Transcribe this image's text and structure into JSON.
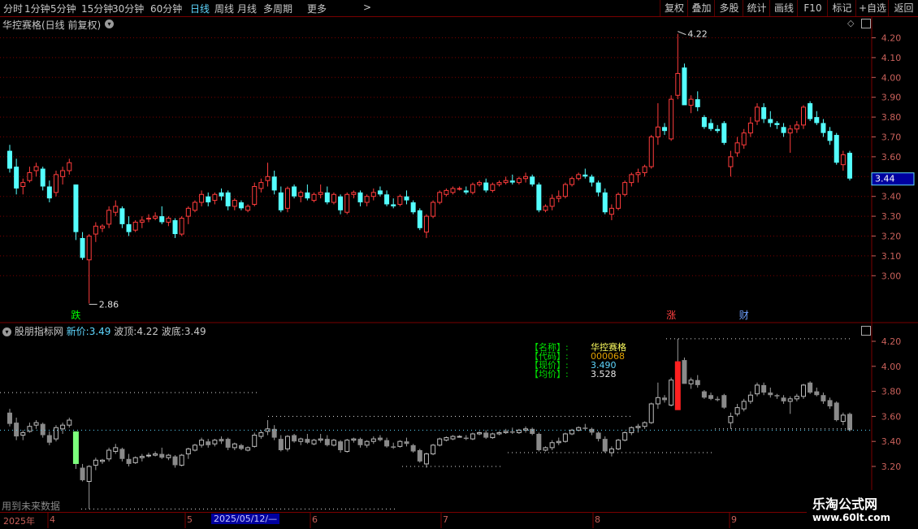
{
  "toolbar": {
    "periods": [
      "分时",
      "1分钟",
      "5分钟",
      "15分钟",
      "30分钟",
      "60分钟",
      "日线",
      "周线",
      "月线",
      "多周期",
      "更多"
    ],
    "more_arrow": ">",
    "active": "日线",
    "right_buttons": [
      "复权",
      "叠加",
      "多股",
      "统计",
      "画线",
      "F10",
      "标记",
      "+自选",
      "返回"
    ]
  },
  "main_panel": {
    "title": "华控赛格(日线 前复权)",
    "price_ticks": [
      "4.20",
      "4.10",
      "4.00",
      "3.90",
      "3.80",
      "3.70",
      "3.60",
      "3.50",
      "3.40",
      "3.30",
      "3.20",
      "3.10",
      "3.00"
    ],
    "current_price": "3.44",
    "high_label": "4.22",
    "low_label": "2.86",
    "markers": [
      {
        "text": "跌",
        "color": "#00ff00"
      },
      {
        "text": "涨",
        "color": "#ff4040"
      },
      {
        "text": "财",
        "color": "#6fa0ff"
      }
    ]
  },
  "sub_panel": {
    "name": "股朋指标网",
    "new_price_label": "新价:",
    "new_price": "3.49",
    "wave_top_label": "波顶:",
    "wave_top": "4.22",
    "wave_bottom_label": "波底:",
    "wave_bottom": "3.49",
    "ticks": [
      "4.20",
      "4.00",
      "3.80",
      "3.60",
      "3.40",
      "3.20"
    ],
    "info": [
      {
        "label": "【名称】:",
        "value": "华控赛格",
        "color": "#ffff60"
      },
      {
        "label": "【代码】:",
        "value": "000068",
        "color": "#e0a000"
      },
      {
        "label": "【现价】:",
        "value": "3.490",
        "color": "#5fd7ff"
      },
      {
        "label": "【均价】:",
        "value": "3.528",
        "color": "#e8e8e8"
      }
    ],
    "future_note": "用到未来数据"
  },
  "date_axis": {
    "labels": [
      "2025年",
      "4",
      "5",
      "6",
      "7",
      "8",
      "9"
    ],
    "cursor_date": "2025/05/12/—"
  },
  "watermark": {
    "line1": "乐淘公式网",
    "line2": "www.60lt.com"
  },
  "colors": {
    "up": "#ff3c3c",
    "down": "#54ffff",
    "grid": "#7a0000",
    "accent": "#5fd7ff"
  },
  "chart_data": {
    "type": "candlestick",
    "candles": [
      [
        3.63,
        3.66,
        3.52,
        3.54
      ],
      [
        3.55,
        3.59,
        3.41,
        3.44
      ],
      [
        3.45,
        3.49,
        3.41,
        3.47
      ],
      [
        3.48,
        3.55,
        3.47,
        3.52
      ],
      [
        3.53,
        3.57,
        3.5,
        3.55
      ],
      [
        3.54,
        3.55,
        3.43,
        3.45
      ],
      [
        3.45,
        3.48,
        3.37,
        3.39
      ],
      [
        3.42,
        3.53,
        3.4,
        3.51
      ],
      [
        3.5,
        3.55,
        3.46,
        3.53
      ],
      [
        3.53,
        3.59,
        3.51,
        3.57
      ],
      [
        3.46,
        3.46,
        3.18,
        3.22
      ],
      [
        3.19,
        3.22,
        3.08,
        3.09
      ],
      [
        3.08,
        3.21,
        2.86,
        3.2
      ],
      [
        3.21,
        3.27,
        3.17,
        3.25
      ],
      [
        3.24,
        3.26,
        3.22,
        3.25
      ],
      [
        3.26,
        3.35,
        3.24,
        3.33
      ],
      [
        3.32,
        3.38,
        3.3,
        3.35
      ],
      [
        3.34,
        3.35,
        3.24,
        3.26
      ],
      [
        3.26,
        3.3,
        3.2,
        3.22
      ],
      [
        3.23,
        3.28,
        3.22,
        3.27
      ],
      [
        3.27,
        3.3,
        3.24,
        3.28
      ],
      [
        3.29,
        3.31,
        3.27,
        3.29
      ],
      [
        3.29,
        3.32,
        3.28,
        3.3
      ],
      [
        3.3,
        3.35,
        3.26,
        3.27
      ],
      [
        3.27,
        3.3,
        3.25,
        3.29
      ],
      [
        3.28,
        3.29,
        3.19,
        3.21
      ],
      [
        3.21,
        3.3,
        3.2,
        3.29
      ],
      [
        3.3,
        3.35,
        3.26,
        3.34
      ],
      [
        3.33,
        3.38,
        3.32,
        3.37
      ],
      [
        3.37,
        3.43,
        3.35,
        3.41
      ],
      [
        3.4,
        3.42,
        3.35,
        3.37
      ],
      [
        3.38,
        3.42,
        3.36,
        3.41
      ],
      [
        3.42,
        3.44,
        3.38,
        3.4
      ],
      [
        3.42,
        3.43,
        3.33,
        3.35
      ],
      [
        3.35,
        3.39,
        3.33,
        3.38
      ],
      [
        3.37,
        3.38,
        3.33,
        3.34
      ],
      [
        3.33,
        3.36,
        3.32,
        3.35
      ],
      [
        3.36,
        3.47,
        3.35,
        3.45
      ],
      [
        3.44,
        3.49,
        3.42,
        3.47
      ],
      [
        3.48,
        3.57,
        3.45,
        3.5
      ],
      [
        3.5,
        3.53,
        3.41,
        3.43
      ],
      [
        3.42,
        3.45,
        3.32,
        3.33
      ],
      [
        3.34,
        3.45,
        3.32,
        3.44
      ],
      [
        3.45,
        3.46,
        3.39,
        3.4
      ],
      [
        3.4,
        3.43,
        3.37,
        3.42
      ],
      [
        3.42,
        3.46,
        3.38,
        3.39
      ],
      [
        3.38,
        3.42,
        3.37,
        3.41
      ],
      [
        3.41,
        3.46,
        3.39,
        3.42
      ],
      [
        3.42,
        3.45,
        3.36,
        3.37
      ],
      [
        3.37,
        3.42,
        3.36,
        3.41
      ],
      [
        3.4,
        3.41,
        3.31,
        3.33
      ],
      [
        3.32,
        3.42,
        3.31,
        3.41
      ],
      [
        3.41,
        3.43,
        3.39,
        3.42
      ],
      [
        3.42,
        3.43,
        3.35,
        3.37
      ],
      [
        3.37,
        3.41,
        3.35,
        3.4
      ],
      [
        3.4,
        3.44,
        3.38,
        3.42
      ],
      [
        3.43,
        3.45,
        3.4,
        3.41
      ],
      [
        3.41,
        3.43,
        3.35,
        3.36
      ],
      [
        3.36,
        3.39,
        3.34,
        3.35
      ],
      [
        3.36,
        3.41,
        3.35,
        3.4
      ],
      [
        3.4,
        3.43,
        3.36,
        3.38
      ],
      [
        3.37,
        3.38,
        3.31,
        3.32
      ],
      [
        3.33,
        3.34,
        3.23,
        3.24
      ],
      [
        3.22,
        3.31,
        3.19,
        3.3
      ],
      [
        3.3,
        3.38,
        3.29,
        3.37
      ],
      [
        3.37,
        3.43,
        3.36,
        3.42
      ],
      [
        3.41,
        3.44,
        3.4,
        3.43
      ],
      [
        3.42,
        3.45,
        3.41,
        3.44
      ],
      [
        3.44,
        3.45,
        3.43,
        3.44
      ],
      [
        3.43,
        3.45,
        3.41,
        3.42
      ],
      [
        3.42,
        3.47,
        3.41,
        3.46
      ],
      [
        3.46,
        3.48,
        3.45,
        3.47
      ],
      [
        3.47,
        3.49,
        3.42,
        3.43
      ],
      [
        3.43,
        3.47,
        3.42,
        3.46
      ],
      [
        3.46,
        3.48,
        3.45,
        3.47
      ],
      [
        3.47,
        3.5,
        3.46,
        3.48
      ],
      [
        3.48,
        3.51,
        3.46,
        3.47
      ],
      [
        3.47,
        3.5,
        3.46,
        3.49
      ],
      [
        3.49,
        3.52,
        3.47,
        3.5
      ],
      [
        3.5,
        3.51,
        3.45,
        3.46
      ],
      [
        3.46,
        3.47,
        3.32,
        3.33
      ],
      [
        3.33,
        3.36,
        3.32,
        3.35
      ],
      [
        3.35,
        3.41,
        3.33,
        3.39
      ],
      [
        3.39,
        3.43,
        3.37,
        3.4
      ],
      [
        3.4,
        3.47,
        3.39,
        3.46
      ],
      [
        3.46,
        3.5,
        3.45,
        3.49
      ],
      [
        3.49,
        3.52,
        3.48,
        3.51
      ],
      [
        3.51,
        3.54,
        3.49,
        3.5
      ],
      [
        3.5,
        3.51,
        3.45,
        3.47
      ],
      [
        3.47,
        3.48,
        3.4,
        3.42
      ],
      [
        3.42,
        3.44,
        3.31,
        3.32
      ],
      [
        3.31,
        3.36,
        3.28,
        3.34
      ],
      [
        3.34,
        3.42,
        3.33,
        3.41
      ],
      [
        3.41,
        3.48,
        3.4,
        3.47
      ],
      [
        3.47,
        3.52,
        3.45,
        3.51
      ],
      [
        3.51,
        3.54,
        3.47,
        3.52
      ],
      [
        3.52,
        3.56,
        3.5,
        3.55
      ],
      [
        3.55,
        3.71,
        3.54,
        3.7
      ],
      [
        3.7,
        3.87,
        3.66,
        3.75
      ],
      [
        3.75,
        3.77,
        3.71,
        3.73
      ],
      [
        3.69,
        3.91,
        3.68,
        3.89
      ],
      [
        3.91,
        4.22,
        3.89,
        4.02
      ],
      [
        4.05,
        4.07,
        3.88,
        3.86
      ],
      [
        3.86,
        3.91,
        3.82,
        3.89
      ],
      [
        3.89,
        3.93,
        3.83,
        3.85
      ],
      [
        3.8,
        3.81,
        3.74,
        3.75
      ],
      [
        3.77,
        3.79,
        3.73,
        3.74
      ],
      [
        3.74,
        3.76,
        3.72,
        3.73
      ],
      [
        3.77,
        3.78,
        3.66,
        3.67
      ],
      [
        3.55,
        3.63,
        3.5,
        3.6
      ],
      [
        3.62,
        3.7,
        3.6,
        3.67
      ],
      [
        3.66,
        3.74,
        3.64,
        3.72
      ],
      [
        3.72,
        3.8,
        3.7,
        3.77
      ],
      [
        3.78,
        3.87,
        3.76,
        3.85
      ],
      [
        3.85,
        3.87,
        3.77,
        3.79
      ],
      [
        3.79,
        3.83,
        3.75,
        3.77
      ],
      [
        3.77,
        3.78,
        3.74,
        3.76
      ],
      [
        3.75,
        3.77,
        3.7,
        3.72
      ],
      [
        3.72,
        3.76,
        3.62,
        3.74
      ],
      [
        3.74,
        3.78,
        3.72,
        3.76
      ],
      [
        3.76,
        3.86,
        3.74,
        3.85
      ],
      [
        3.87,
        3.88,
        3.78,
        3.79
      ],
      [
        3.8,
        3.83,
        3.76,
        3.77
      ],
      [
        3.77,
        3.79,
        3.7,
        3.72
      ],
      [
        3.73,
        3.75,
        3.66,
        3.68
      ],
      [
        3.71,
        3.72,
        3.56,
        3.57
      ],
      [
        3.56,
        3.63,
        3.53,
        3.61
      ],
      [
        3.62,
        3.63,
        3.48,
        3.49
      ]
    ]
  }
}
